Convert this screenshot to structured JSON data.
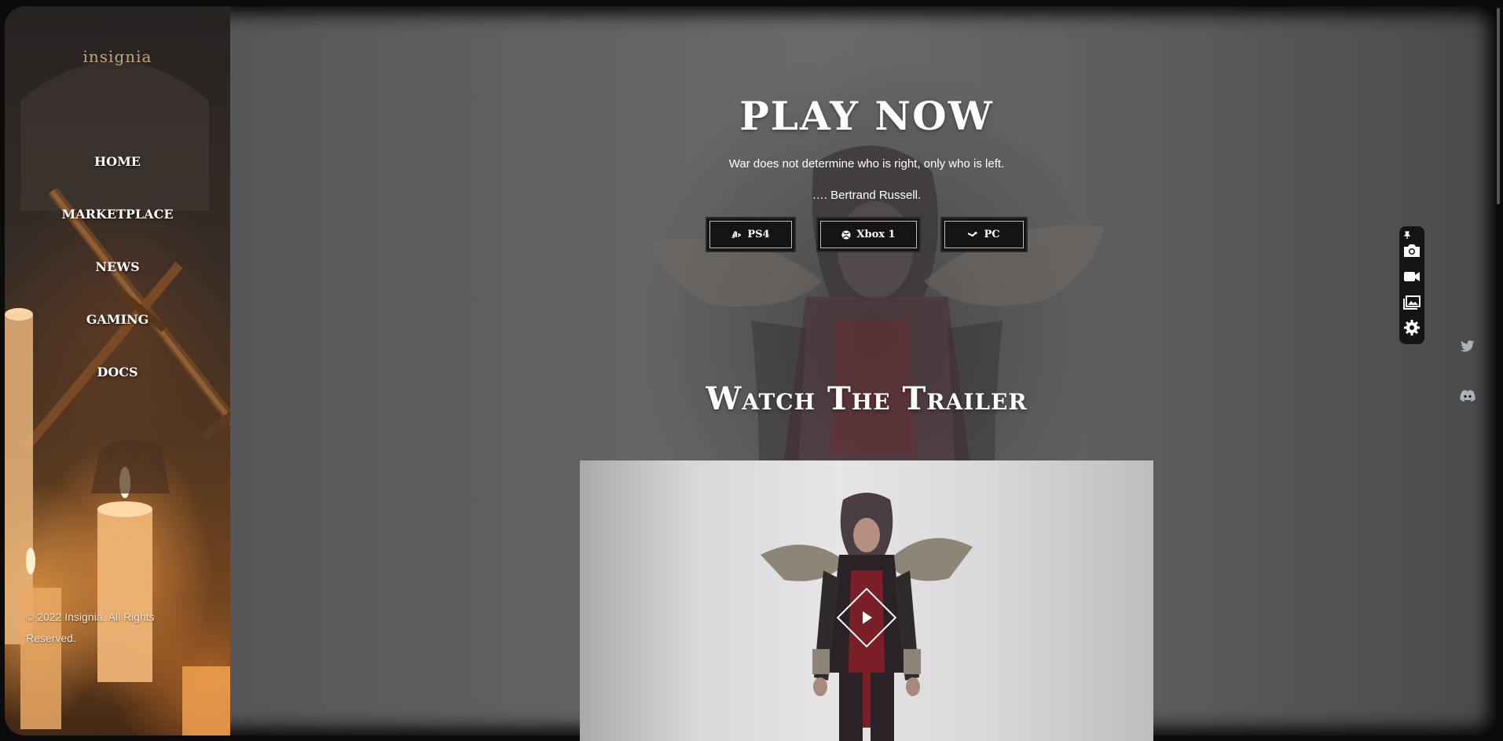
{
  "sidebar": {
    "logo_text": "insignia",
    "nav": [
      {
        "label": "HOME"
      },
      {
        "label": "MARKETPLACE"
      },
      {
        "label": "NEWS"
      },
      {
        "label": "GAMING"
      },
      {
        "label": "DOCS"
      }
    ],
    "copyright": "© 2022 Insignia. All Rights Reserved."
  },
  "hero": {
    "title": "PLAY NOW",
    "quote": "War does not determine who is right, only who is left.",
    "author": "…. Bertrand Russell."
  },
  "platforms": [
    {
      "label": "PS4",
      "icon": "playstation-icon"
    },
    {
      "label": "Xbox 1",
      "icon": "xbox-icon"
    },
    {
      "label": "PC",
      "icon": "steam-icon"
    }
  ],
  "trailer": {
    "heading": "Watch The Trailer",
    "play_icon": "play-icon"
  },
  "toolbar": {
    "items": [
      "pin-icon",
      "camera-icon",
      "video-camera-icon",
      "gallery-icon",
      "settings-icon"
    ]
  },
  "social": [
    "twitter-icon",
    "discord-icon"
  ],
  "colors": {
    "background": "#5e5e60",
    "frame": "#0b0b0b",
    "button_bg": "#141414",
    "accent_gold": "#d9bf8e"
  }
}
